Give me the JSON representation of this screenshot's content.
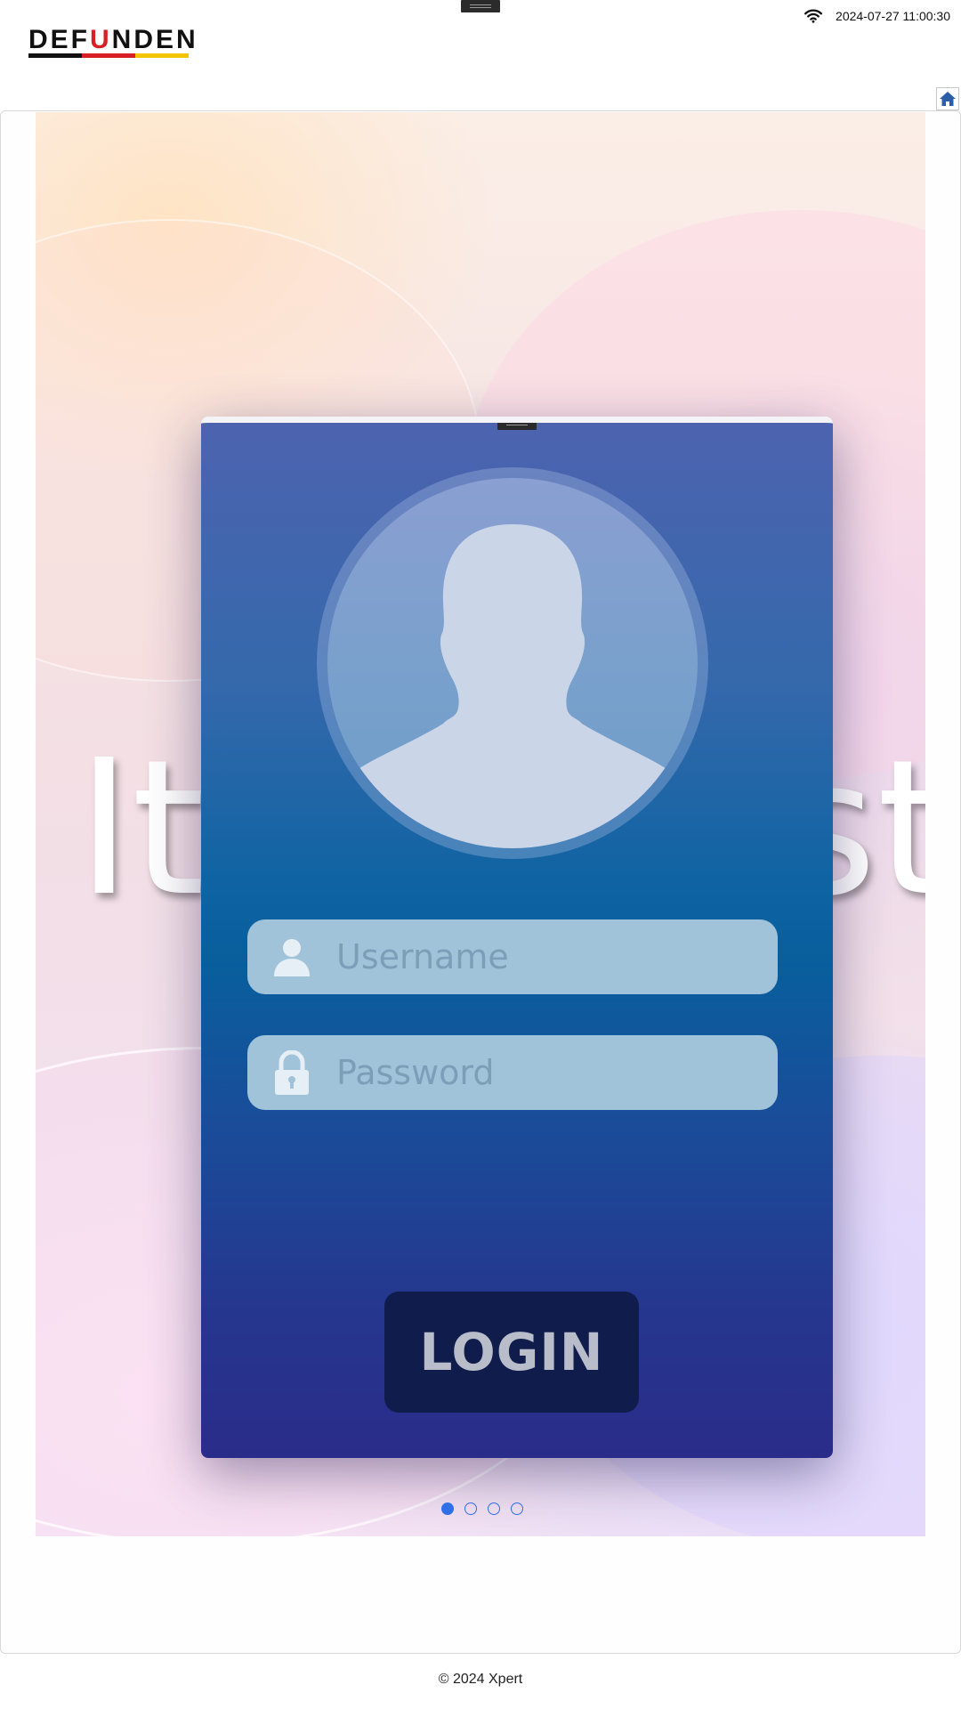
{
  "header": {
    "logo_text_left": "DEF",
    "logo_text_mid": "U",
    "logo_text_right": "NDEN",
    "logo_colors": [
      "#111111",
      "#d81f26",
      "#f2c500"
    ],
    "datetime": "2024-07-27 11:00:30",
    "wifi_icon": "wifi-icon",
    "home_icon": "home-icon"
  },
  "slide": {
    "background_word_left": "It",
    "background_word_right": "st",
    "login_card": {
      "username_placeholder": "Username",
      "password_placeholder": "Password",
      "login_label": "LOGIN"
    },
    "pagination": {
      "count": 4,
      "active_index": 0,
      "accent": "#2f6fe8"
    }
  },
  "footer": {
    "copyright": "© 2024 Xpert"
  }
}
